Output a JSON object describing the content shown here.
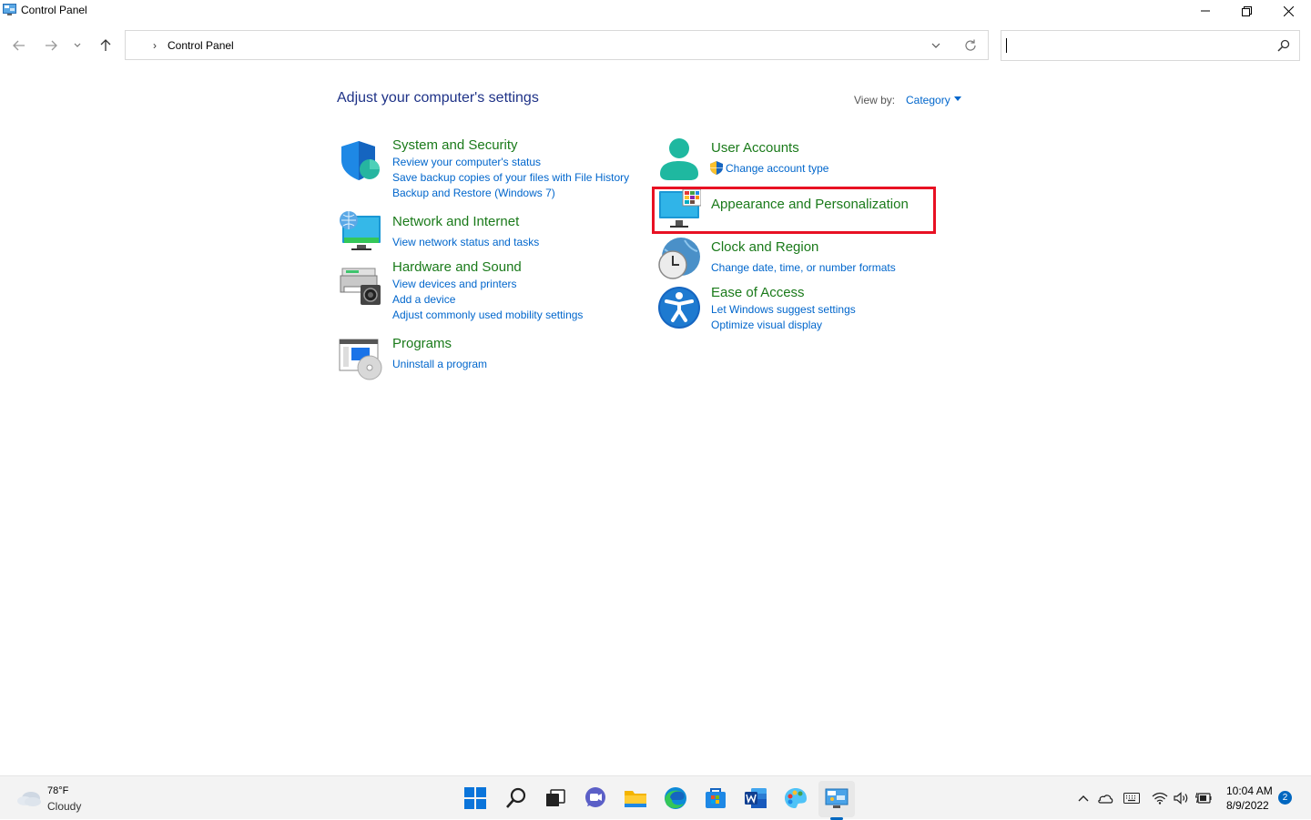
{
  "window": {
    "title": "Control Panel"
  },
  "address": {
    "crumb": "Control Panel"
  },
  "search": {
    "placeholder": ""
  },
  "page": {
    "title": "Adjust your computer's settings",
    "view_by_label": "View by:",
    "view_by_value": "Category"
  },
  "categories": {
    "system_security": {
      "title": "System and Security",
      "links": [
        "Review your computer's status",
        "Save backup copies of your files with File History",
        "Backup and Restore (Windows 7)"
      ]
    },
    "network": {
      "title": "Network and Internet",
      "links": [
        "View network status and tasks"
      ]
    },
    "hardware": {
      "title": "Hardware and Sound",
      "links": [
        "View devices and printers",
        "Add a device",
        "Adjust commonly used mobility settings"
      ]
    },
    "programs": {
      "title": "Programs",
      "links": [
        "Uninstall a program"
      ]
    },
    "user_accounts": {
      "title": "User Accounts",
      "links": [
        "Change account type"
      ]
    },
    "appearance": {
      "title": "Appearance and Personalization"
    },
    "clock": {
      "title": "Clock and Region",
      "links": [
        "Change date, time, or number formats"
      ]
    },
    "ease": {
      "title": "Ease of Access",
      "links": [
        "Let Windows suggest settings",
        "Optimize visual display"
      ]
    }
  },
  "taskbar": {
    "weather_temp": "78°F",
    "weather_desc": "Cloudy",
    "time": "10:04 AM",
    "date": "8/9/2022",
    "notifications": "2"
  },
  "colors": {
    "title_green": "#1a7a1a",
    "link_blue": "#0066cc",
    "heading_blue": "#1e3287",
    "highlight_red": "#e81123"
  }
}
